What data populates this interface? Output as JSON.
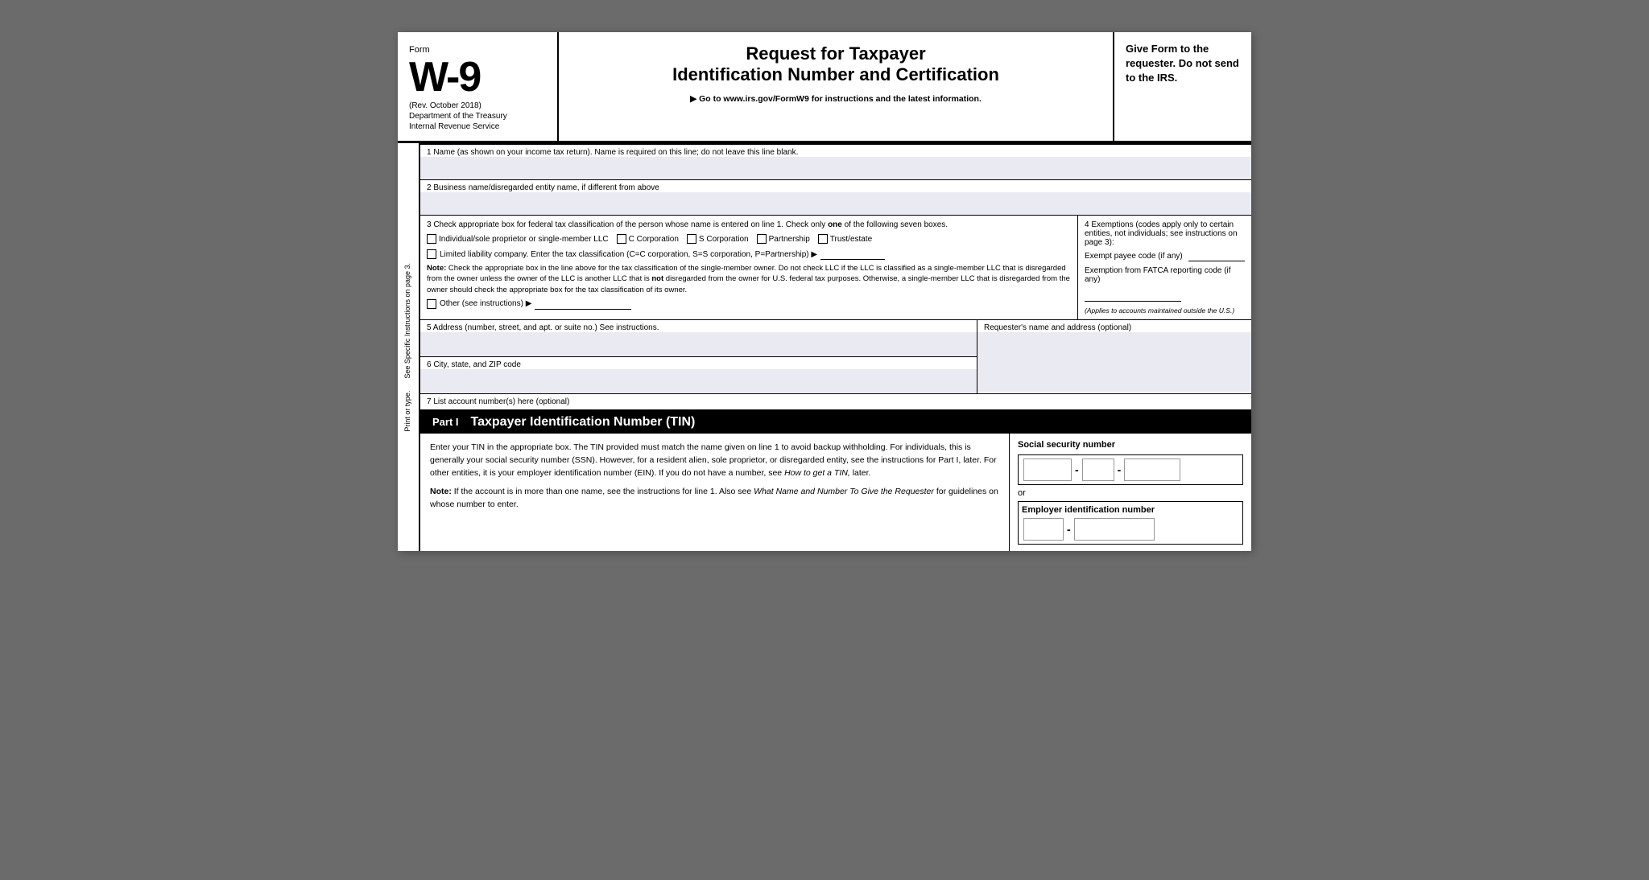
{
  "header": {
    "form_label": "Form",
    "form_number": "W-9",
    "rev": "(Rev. October 2018)",
    "dept1": "Department of the Treasury",
    "dept2": "Internal Revenue Service",
    "title_line1": "Request for Taxpayer",
    "title_line2": "Identification Number and Certification",
    "subtitle": "▶ Go to www.irs.gov/FormW9 for instructions and the latest information.",
    "instructions": "Give Form to the requester. Do not send to the IRS."
  },
  "sidebar": {
    "print_text": "Print or type.",
    "see_text": "See Specific Instructions on page 3."
  },
  "rows": {
    "row1_label": "1  Name (as shown on your income tax return). Name is required on this line; do not leave this line blank.",
    "row2_label": "2  Business name/disregarded entity name, if different from above",
    "row3_label_main": "3  Check appropriate box for federal tax classification of the person whose name is entered on line 1. Check only",
    "row3_label_one": "one",
    "row3_label_rest": "of the following seven boxes.",
    "checkbox_individual": "Individual/sole proprietor or single-member LLC",
    "checkbox_c_corp": "C Corporation",
    "checkbox_s_corp": "S Corporation",
    "checkbox_partnership": "Partnership",
    "checkbox_trust": "Trust/estate",
    "llc_label": "Limited liability company. Enter the tax classification (C=C corporation, S=S corporation, P=Partnership) ▶",
    "note_label": "Note:",
    "note_text": "Check the appropriate box in the line above for the tax classification of the single-member owner. Do not check LLC if the LLC is classified as a single-member LLC that is disregarded from the owner unless the owner of the LLC is another LLC that is",
    "note_not": "not",
    "note_text2": "disregarded from the owner for U.S. federal tax purposes. Otherwise, a single-member LLC that is disregarded from the owner should check the appropriate box for the tax classification of its owner.",
    "other_label": "Other (see instructions) ▶",
    "row4_title": "4  Exemptions (codes apply only to certain entities, not individuals; see instructions on page 3):",
    "exempt_payee_label": "Exempt payee code (if any)",
    "fatca_label": "Exemption from FATCA reporting code (if any)",
    "applies_note": "(Applies to accounts maintained outside the U.S.)",
    "row5_label": "5  Address (number, street, and apt. or suite no.) See instructions.",
    "requester_label": "Requester's name and address (optional)",
    "row6_label": "6  City, state, and ZIP code",
    "row7_label": "7  List account number(s) here (optional)"
  },
  "part1": {
    "label": "Part I",
    "title": "Taxpayer Identification Number (TIN)",
    "body_text1": "Enter your TIN in the appropriate box. The TIN provided must match the name given on line 1 to avoid backup withholding. For individuals, this is generally your social security number (SSN). However, for a resident alien, sole proprietor, or disregarded entity, see the instructions for Part I, later. For other entities, it is your employer identification number (EIN). If you do not have a number, see",
    "how_to_get": "How to get a TIN,",
    "body_text2": "later.",
    "note_label": "Note:",
    "note_text": "If the account is in more than one name, see the instructions for line 1. Also see",
    "what_name": "What Name and Number To Give the Requester",
    "note_text2": "for guidelines on whose number to enter.",
    "ssn_label": "Social security number",
    "or_text": "or",
    "ein_label": "Employer identification number"
  }
}
